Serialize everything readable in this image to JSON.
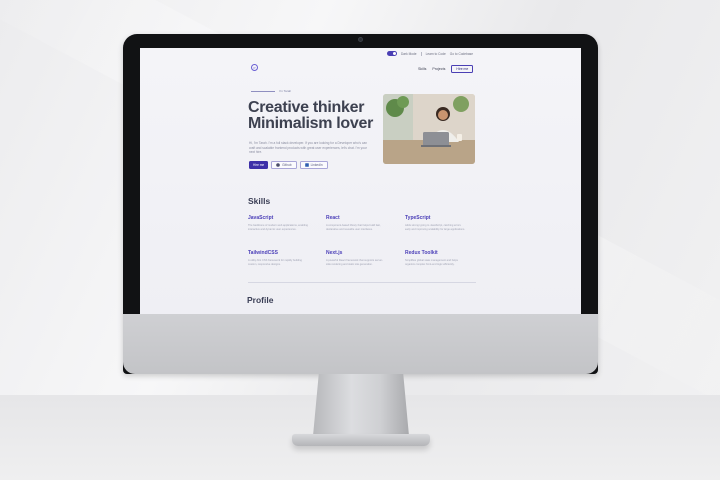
{
  "topbar": {
    "mode_label": "Dark Mode",
    "links": [
      "Learn to Code",
      "Go to Codebase"
    ]
  },
  "logo_text": "P",
  "nav": {
    "items": [
      "Skills",
      "Projects"
    ],
    "hire_label": "Hire me"
  },
  "hero": {
    "eyebrow": "I'm Tarah",
    "headline_line1": "Creative thinker",
    "headline_line2": "Minimalism lover",
    "intro": "Hi, I'm Tarah. I'm a full stack developer. If you are looking for a Developer who's can craft and scalable frontend products with great user experiences, let's chat. I'm your next hire.",
    "buttons": {
      "hire": "Hire me",
      "github": "Github",
      "linkedin": "LinkedIn"
    }
  },
  "skills": {
    "title": "Skills",
    "items": [
      {
        "name": "JavaScript",
        "desc": "The backbone of modern web applications, enabling interactive and dynamic user experiences."
      },
      {
        "name": "React",
        "desc": "A component-based library that helps build fast, declarative and reusable user interfaces."
      },
      {
        "name": "TypeScript",
        "desc": "Adds strong typing to JavaScript, catching errors early and improving scalability for large applications."
      },
      {
        "name": "TailwindCSS",
        "desc": "A utility-first CSS framework for rapidly building custom, responsive designs."
      },
      {
        "name": "Next.js",
        "desc": "A powerful React framework that supports server-side rendering and static site generation."
      },
      {
        "name": "Redux Toolkit",
        "desc": "Simplifies global state management and helps organize complex front-end logic efficiently."
      }
    ]
  },
  "profile": {
    "title": "Profile"
  },
  "colors": {
    "accent": "#4a3fb4",
    "heading": "#3d4150"
  }
}
